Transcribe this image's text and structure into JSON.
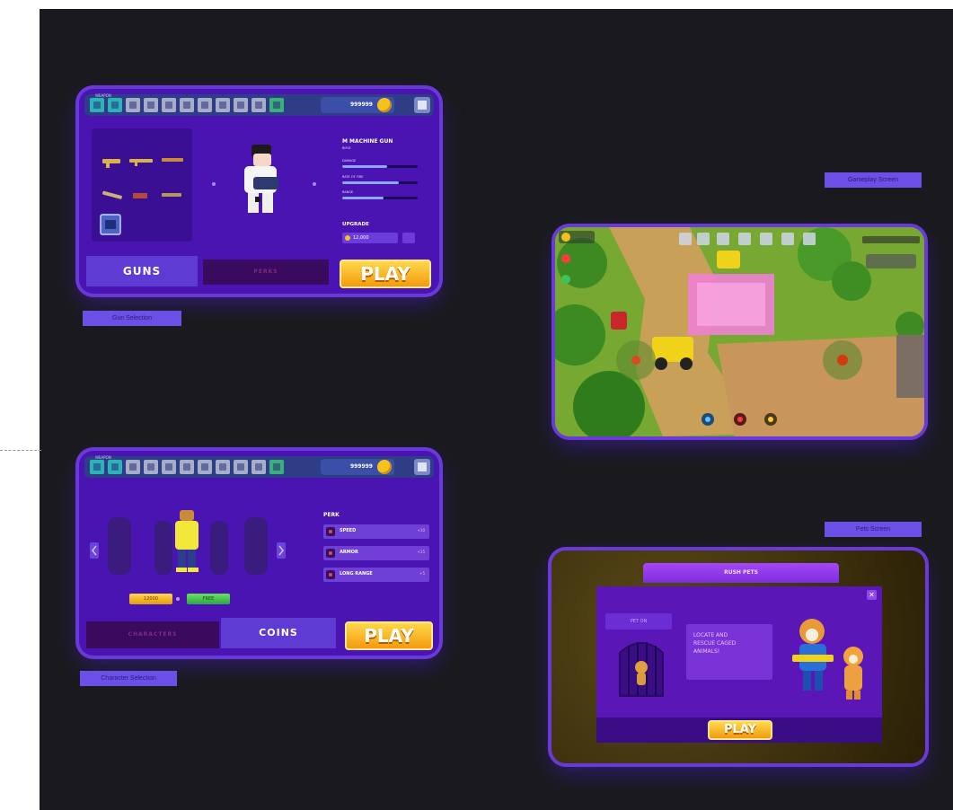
{
  "labels": {
    "gun_selection": "Gun Selection",
    "character_selection": "Character Selection",
    "gameplay_screen": "Gameplay Screen",
    "pets_screen": "Pets Screen"
  },
  "gun_screen": {
    "tiny_top": "WEAPON",
    "coins": "999999",
    "gun_name": "M MACHINE GUN",
    "gun_sub": "RIFLE",
    "stats": [
      {
        "name": "DAMAGE",
        "value": 0.6
      },
      {
        "name": "RATE OF FIRE",
        "value": 0.75
      },
      {
        "name": "RANGE",
        "value": 0.55
      }
    ],
    "upgrade_label": "UPGRADE",
    "upgrade_cost": "12,000",
    "tab_active": "GUNS",
    "tab_inactive": "PERKS",
    "play": "PLAY"
  },
  "char_screen": {
    "tiny_top": "WEAPON",
    "coins": "999999",
    "perks_title": "PERK",
    "perks": [
      {
        "name": "SPEED",
        "value": "+10"
      },
      {
        "name": "ARMOR",
        "value": "+15"
      },
      {
        "name": "LONG RANGE",
        "value": "+5"
      }
    ],
    "price_gold": "12000",
    "price_green": "FREE",
    "tab_inactive": "CHARACTERS",
    "tab_active": "COINS",
    "play": "PLAY"
  },
  "pets_screen": {
    "header": "RUSH PETS",
    "pet_label": "PET ON",
    "message_line1": "LOCATE AND",
    "message_line2": "RESCUE CAGED",
    "message_line3": "ANIMALS!",
    "play": "PLAY",
    "close": "✕"
  },
  "icons": [
    "coin-icon",
    "store-icon",
    "joystick-icon",
    "close-icon",
    "arrow-left-icon",
    "arrow-right-icon"
  ]
}
